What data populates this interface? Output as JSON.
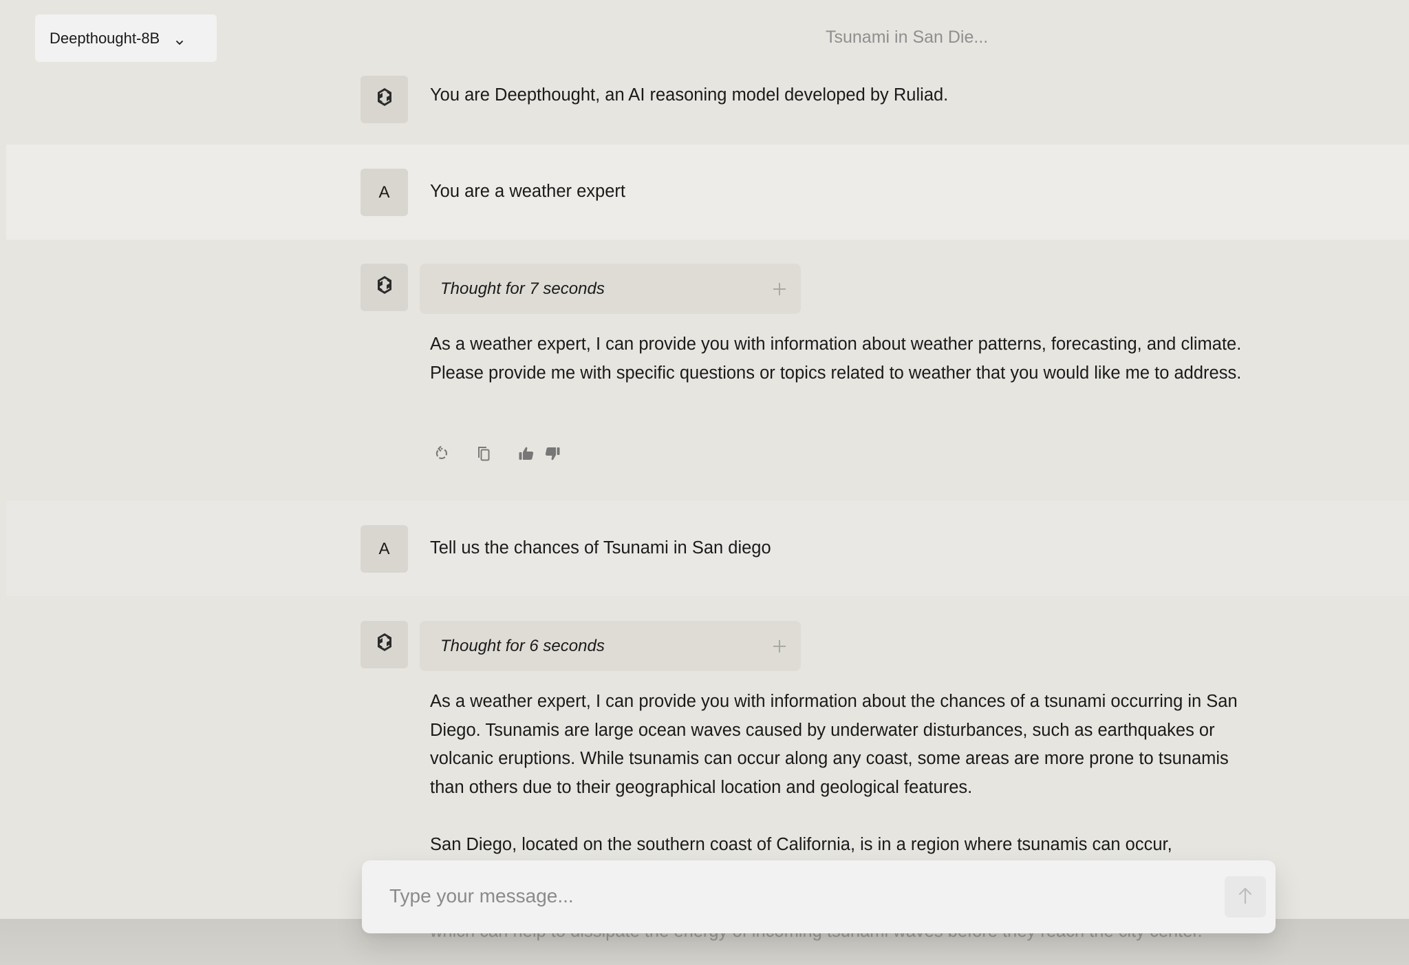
{
  "header": {
    "model_selector": {
      "label": "Deepthought-8B",
      "icon": "chevron-down-icon"
    },
    "chat_title": "Tsunami in San Die..."
  },
  "messages": [
    {
      "role": "system",
      "avatar_icon": "deepthought-logo-icon",
      "text": "You are Deepthought, an AI reasoning model developed by Ruliad."
    },
    {
      "role": "user",
      "avatar_initial": "A",
      "text": "You are a weather expert"
    },
    {
      "role": "assistant",
      "avatar_icon": "deepthought-logo-icon",
      "thought_label": "Thought for 7 seconds",
      "thought_toggle_icon": "plus-icon",
      "paragraphs": [
        "As a weather expert, I can provide you with information about weather patterns, forecasting, and climate. Please provide me with specific questions or topics related to weather that you would like me to address."
      ],
      "actions": [
        {
          "name": "regenerate",
          "icon": "refresh-icon"
        },
        {
          "name": "copy",
          "icon": "copy-icon"
        },
        {
          "name": "thumbs-up",
          "icon": "thumbs-up-icon"
        },
        {
          "name": "thumbs-down",
          "icon": "thumbs-down-icon"
        }
      ]
    },
    {
      "role": "user",
      "avatar_initial": "A",
      "text": "Tell us the chances of Tsunami in San diego"
    },
    {
      "role": "assistant",
      "avatar_icon": "deepthought-logo-icon",
      "thought_label": "Thought for 6 seconds",
      "thought_toggle_icon": "plus-icon",
      "paragraphs": [
        "As a weather expert, I can provide you with information about the chances of a tsunami occurring in San Diego. Tsunamis are large ocean waves caused by underwater disturbances, such as earthquakes or volcanic eruptions. While tsunamis can occur along any coast, some areas are more prone to tsunamis than others due to their geographical location and geological features.",
        "San Diego, located on the southern coast of California, is in a region where tsunamis can occur,"
      ],
      "obscured_text": "which can help to dissipate the energy of incoming tsunami waves before they reach the city center."
    }
  ],
  "composer": {
    "placeholder": "Type your message...",
    "value": "",
    "send_icon": "arrow-up-icon"
  }
}
